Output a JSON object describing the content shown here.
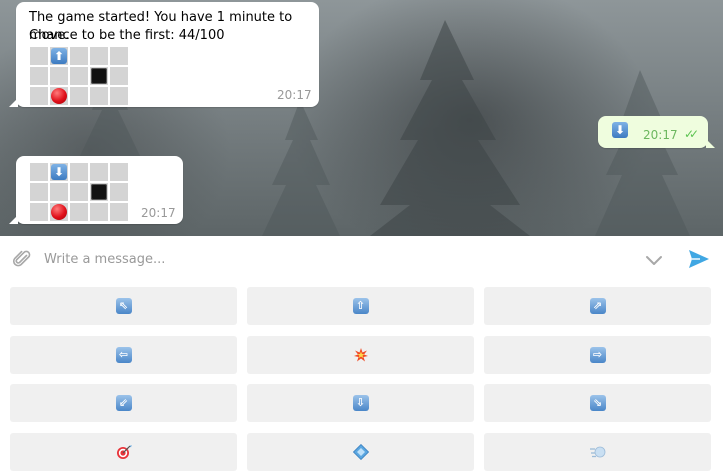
{
  "messages": [
    {
      "text_line1": "The game started! You have 1 minute to move.",
      "text_line2": "Chance to be the first: 44/100",
      "time": "20:17",
      "board_arrow": "up-arrow-key"
    },
    {
      "time": "20:17",
      "board_arrow": "down-arrow-key"
    }
  ],
  "outgoing": {
    "emoji": "down-arrow-key",
    "time": "20:17",
    "status": "read-double-check"
  },
  "input": {
    "placeholder": "Write a message..."
  },
  "keyboard": {
    "rows": [
      [
        "up-left-arrow",
        "up-arrow",
        "up-right-arrow"
      ],
      [
        "left-arrow",
        "collision",
        "right-arrow"
      ],
      [
        "down-left-arrow",
        "down-arrow",
        "down-right-arrow"
      ],
      [
        "direct-hit",
        "diamond-shape",
        "dashing-away"
      ]
    ]
  },
  "colors": {
    "bubble_in": "#ffffff",
    "bubble_out": "#effdde",
    "time_text": "#999999",
    "read_check": "#5dc452",
    "send_icon": "#40a7e3",
    "key_button": "#f0f0f0",
    "board_cell": "#d4d4d4"
  }
}
